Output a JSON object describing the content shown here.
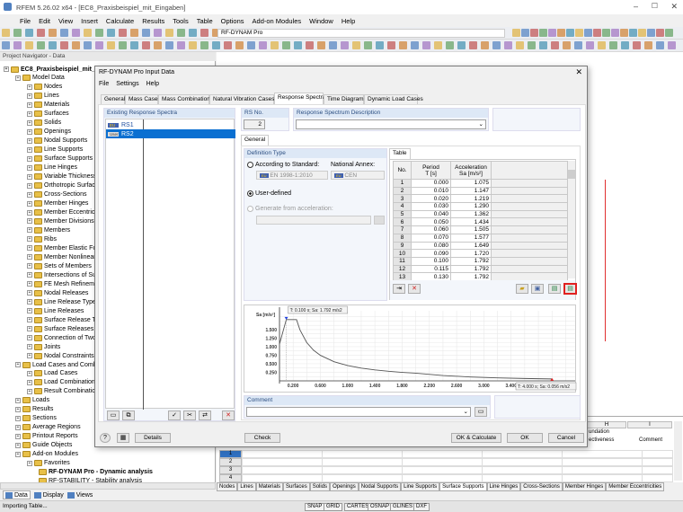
{
  "app": {
    "title": "RFEM 5.26.02 x64 - [EC8_Praxisbeispiel_mit_Eingaben]",
    "module_dropdown": "RF-DYNAM Pro"
  },
  "menu": [
    "File",
    "Edit",
    "View",
    "Insert",
    "Calculate",
    "Results",
    "Tools",
    "Table",
    "Options",
    "Add-on Modules",
    "Window",
    "Help"
  ],
  "navigator": {
    "title": "Project Navigator - Data",
    "items": [
      {
        "label": "EC8_Praxisbeispiel_mit_Eingaben",
        "level": 0,
        "bold": true
      },
      {
        "label": "Model Data",
        "level": 1
      },
      {
        "label": "Nodes",
        "level": 2
      },
      {
        "label": "Lines",
        "level": 2
      },
      {
        "label": "Materials",
        "level": 2
      },
      {
        "label": "Surfaces",
        "level": 2
      },
      {
        "label": "Solids",
        "level": 2
      },
      {
        "label": "Openings",
        "level": 2
      },
      {
        "label": "Nodal Supports",
        "level": 2
      },
      {
        "label": "Line Supports",
        "level": 2
      },
      {
        "label": "Surface Supports",
        "level": 2
      },
      {
        "label": "Line Hinges",
        "level": 2
      },
      {
        "label": "Variable Thicknesses",
        "level": 2
      },
      {
        "label": "Orthotropic Surfaces",
        "level": 2
      },
      {
        "label": "Cross-Sections",
        "level": 2
      },
      {
        "label": "Member Hinges",
        "level": 2
      },
      {
        "label": "Member Eccentricities",
        "level": 2
      },
      {
        "label": "Member Divisions",
        "level": 2
      },
      {
        "label": "Members",
        "level": 2
      },
      {
        "label": "Ribs",
        "level": 2
      },
      {
        "label": "Member Elastic Foundations",
        "level": 2
      },
      {
        "label": "Member Nonlinearities",
        "level": 2
      },
      {
        "label": "Sets of Members",
        "level": 2
      },
      {
        "label": "Intersections of Surfaces",
        "level": 2
      },
      {
        "label": "FE Mesh Refinements",
        "level": 2
      },
      {
        "label": "Nodal Releases",
        "level": 2
      },
      {
        "label": "Line Release Types",
        "level": 2
      },
      {
        "label": "Line Releases",
        "level": 2
      },
      {
        "label": "Surface Release Types",
        "level": 2
      },
      {
        "label": "Surface Releases",
        "level": 2
      },
      {
        "label": "Connection of Two Members",
        "level": 2
      },
      {
        "label": "Joints",
        "level": 2
      },
      {
        "label": "Nodal Constraints",
        "level": 2
      },
      {
        "label": "Load Cases and Combinations",
        "level": 1
      },
      {
        "label": "Load Cases",
        "level": 2
      },
      {
        "label": "Load Combinations",
        "level": 2
      },
      {
        "label": "Result Combinations",
        "level": 2
      },
      {
        "label": "Loads",
        "level": 1
      },
      {
        "label": "Results",
        "level": 1
      },
      {
        "label": "Sections",
        "level": 1
      },
      {
        "label": "Average Regions",
        "level": 1
      },
      {
        "label": "Printout Reports",
        "level": 1
      },
      {
        "label": "Guide Objects",
        "level": 1
      },
      {
        "label": "Add-on Modules",
        "level": 1
      },
      {
        "label": "Favorites",
        "level": 2
      },
      {
        "label": "RF-DYNAM Pro - Dynamic analysis",
        "level": 3,
        "bold": true
      },
      {
        "label": "RF-STABILITY - Stability analysis",
        "level": 3
      }
    ],
    "tabs": [
      "Data",
      "Display",
      "Views"
    ]
  },
  "dialog": {
    "title": "RF-DYNAM Pro Input Data",
    "menu": [
      "File",
      "Settings",
      "Help"
    ],
    "tabs": [
      "General",
      "Mass Cases",
      "Mass Combinations",
      "Natural Vibration Cases",
      "Response Spectra",
      "Time Diagrams",
      "Dynamic Load Cases"
    ],
    "active_tab": "Response Spectra",
    "existing_title": "Existing Response Spectra",
    "spectra": [
      {
        "badge": "EU",
        "name": "RS1"
      },
      {
        "badge": "User",
        "name": "RS2",
        "selected": true
      }
    ],
    "rs_no_label": "RS No.",
    "rs_no": "2",
    "description_label": "Response Spectrum Description",
    "description_value": "",
    "subtab": "General",
    "definition_type": "Definition Type",
    "according_label": "According to Standard:",
    "national_annex_label": "National Annex:",
    "standard_value": "EN 1998-1:2010",
    "annex_value": "CEN",
    "user_defined_label": "User-defined",
    "generate_label": "Generate from acceleration:",
    "selected_option": "User-defined",
    "table_tab": "Table",
    "table_headers": {
      "no": "No.",
      "period": "Period",
      "period_unit": "T [s]",
      "accel": "Acceleration",
      "accel_unit": "Sa [m/s²]"
    },
    "table_rows": [
      [
        "1",
        "0.000",
        "1.075"
      ],
      [
        "2",
        "0.010",
        "1.147"
      ],
      [
        "3",
        "0.020",
        "1.219"
      ],
      [
        "4",
        "0.030",
        "1.290"
      ],
      [
        "5",
        "0.040",
        "1.362"
      ],
      [
        "6",
        "0.050",
        "1.434"
      ],
      [
        "7",
        "0.060",
        "1.505"
      ],
      [
        "8",
        "0.070",
        "1.577"
      ],
      [
        "9",
        "0.080",
        "1.649"
      ],
      [
        "10",
        "0.090",
        "1.720"
      ],
      [
        "11",
        "0.100",
        "1.792"
      ],
      [
        "12",
        "0.115",
        "1.792"
      ],
      [
        "13",
        "0.130",
        "1.792"
      ]
    ],
    "comment_label": "Comment",
    "comment_value": "",
    "buttons": {
      "details": "Details",
      "check": "Check",
      "ok_calc": "OK & Calculate",
      "ok": "OK",
      "cancel": "Cancel"
    }
  },
  "chart_data": {
    "type": "line",
    "ylabel": "Sa [m/s²]",
    "x": [
      0,
      0.1,
      0.25,
      0.3,
      0.4,
      0.5,
      0.6,
      0.8,
      1.0,
      1.2,
      1.4,
      1.6,
      1.8,
      2.0,
      2.4,
      2.8,
      3.2,
      3.6,
      4.0
    ],
    "y": [
      1.075,
      1.792,
      1.792,
      1.493,
      1.12,
      0.896,
      0.747,
      0.56,
      0.448,
      0.373,
      0.32,
      0.28,
      0.249,
      0.224,
      0.156,
      0.114,
      0.088,
      0.069,
      0.056
    ],
    "xticks": [
      "0.200",
      "0.600",
      "1.000",
      "1.400",
      "1.800",
      "2.200",
      "2.600",
      "3.000",
      "3.400"
    ],
    "yticks": [
      "0.250",
      "0.500",
      "0.750",
      "1.000",
      "1.250",
      "1.500"
    ],
    "xlim": [
      0,
      4.34
    ],
    "ylim": [
      0,
      2.05
    ],
    "grid": true,
    "annotations": [
      "T: 0.100 s; Sa: 1.792 m/s2",
      "T: 4.000 s; Sa: 0.056 m/s2"
    ],
    "line_color": "#555555"
  },
  "lower_table": {
    "col_h": "H",
    "col_i": "I",
    "h_text1": "undation",
    "h_text2": "ectiveness",
    "comment": "Comment",
    "rows": [
      "1",
      "2",
      "3",
      "4"
    ]
  },
  "bottom_tabs": [
    "Nodes",
    "Lines",
    "Materials",
    "Surfaces",
    "Solids",
    "Openings",
    "Nodal Supports",
    "Line Supports",
    "Surface Supports",
    "Line Hinges",
    "Cross-Sections",
    "Member Hinges",
    "Member Eccentricities"
  ],
  "active_bottom_tab": "Surface Supports",
  "status": {
    "text": "Importing Table...",
    "toggles": [
      "SNAP",
      "GRID",
      "CARTES",
      "OSNAP",
      "GLINES",
      "DXF"
    ]
  },
  "colors": {
    "accent": "#0078d7",
    "selection": "#0a6fd1",
    "highlight_border": "#e02020"
  }
}
